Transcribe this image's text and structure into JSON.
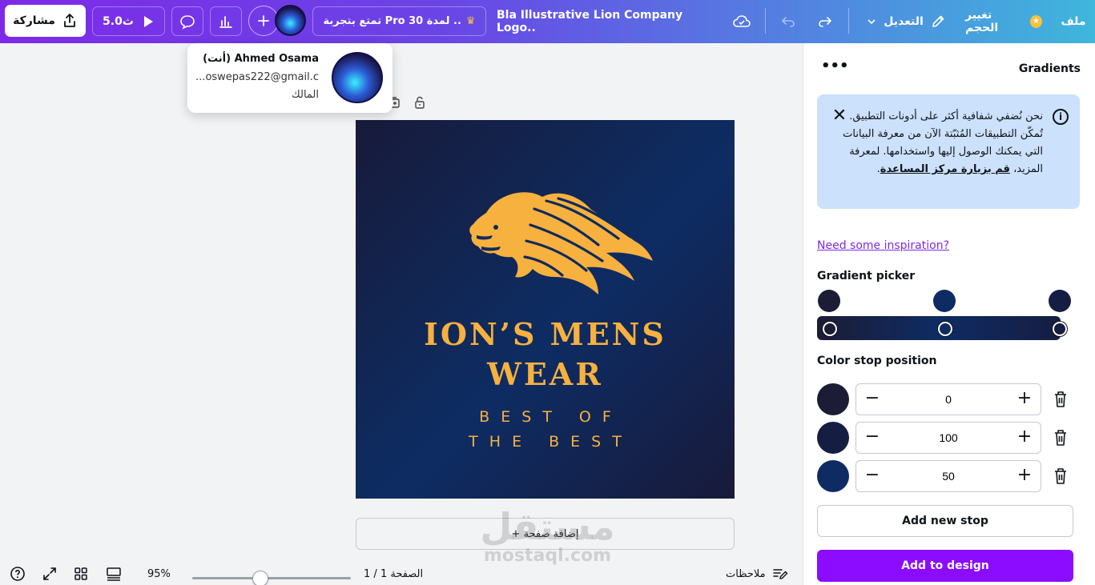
{
  "topbar": {
    "share_label": "مشاركة",
    "play_label": "5.0ث",
    "pro_label": "تمتع بتجربة Pro لمدة 30 ..",
    "doc_title": "Bla Illustrative Lion Company Logo..",
    "edit_label": "التعديل",
    "resize_label": "تغيير الحجم",
    "file_label": "ملف"
  },
  "account": {
    "name": "Ahmed Osama (أنت)",
    "email": "oswepas222@gmail.c...",
    "role": "المالك"
  },
  "design": {
    "brand_line1": "ION’S MENS",
    "brand_line2": "WEAR",
    "tagline_line1": "BEST OF",
    "tagline_line2": "THE BEST",
    "accent_color": "#f7b13f"
  },
  "canvas": {
    "add_page_label": "+ إضافة صفحة",
    "watermark_ar": "مستقل",
    "watermark_en": "mostaql.com"
  },
  "bottombar": {
    "zoom": "95%",
    "zoom_fraction": 0.43,
    "page_indicator": "الصفحة 1 / 1",
    "notes_label": "ملاحظات"
  },
  "panel": {
    "title": "Gradients",
    "info_text": "نحن نُضفي شفافية أكثر على أدونات التطبيق. تُمكّن التطبيقات المُثبّتة الآن من معرفة البيانات التي يمكنك الوصول إليها واستخدامها. لمعرفة المزيد،",
    "info_link": "قم بزيارة مركز المساعدة",
    "inspiration_link": "Need some inspiration?",
    "gradient_picker_label": "Gradient picker",
    "color_stop_label": "Color stop position",
    "add_stop_label": "Add new stop",
    "add_to_design_label": "Add to design",
    "stops": [
      {
        "color": "#1c1c36",
        "value": "0"
      },
      {
        "color": "#161d42",
        "value": "100"
      },
      {
        "color": "#0e2c63",
        "value": "50"
      }
    ],
    "picker_colors": [
      "#1c1c36",
      "#0e2c63",
      "#161d42"
    ]
  }
}
